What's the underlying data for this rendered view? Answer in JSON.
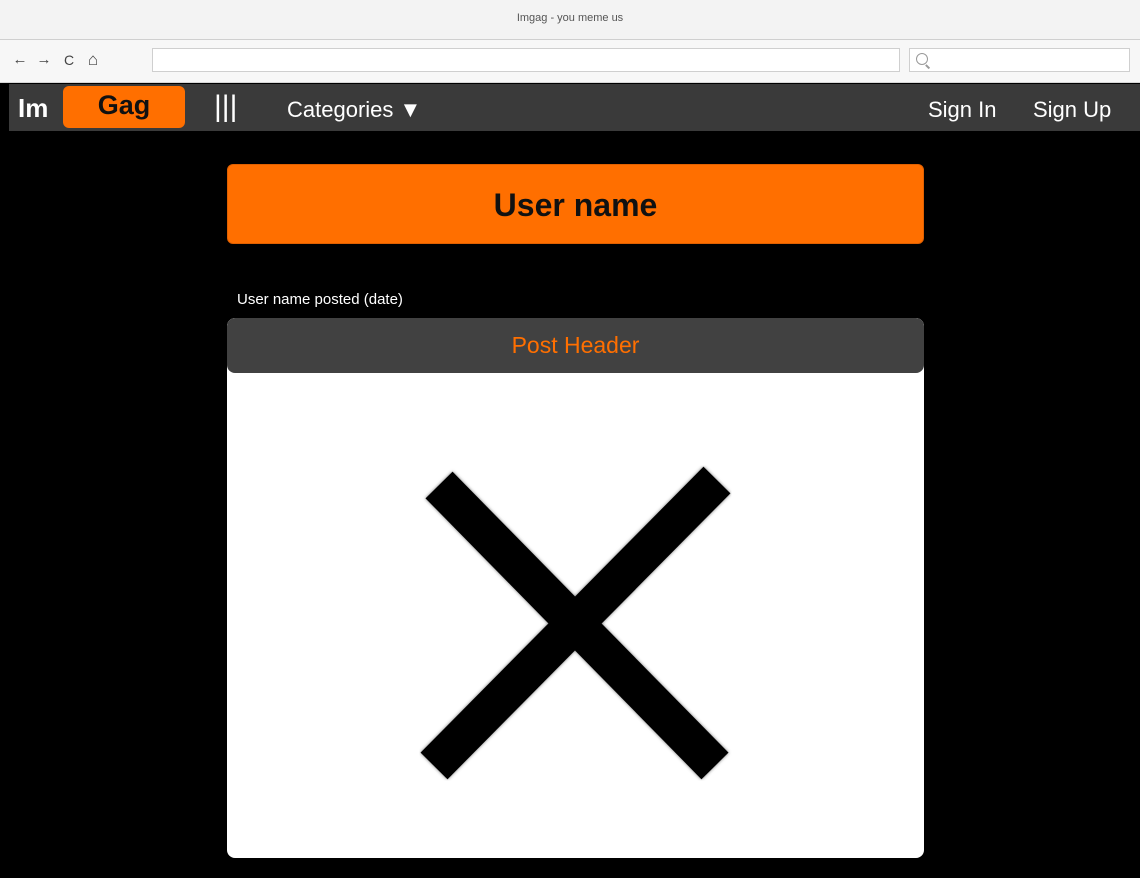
{
  "browser": {
    "window_title": "Imgag - you meme us",
    "nav": {
      "back": "←",
      "forward": "→",
      "reload": "C",
      "home": "⌂"
    },
    "url": ""
  },
  "header": {
    "logo_im": "Im",
    "logo_gag": "Gag",
    "menu_glyph": "|||",
    "categories_label": "Categories ▼",
    "sign_in": "Sign In",
    "sign_up": "Sign Up"
  },
  "profile": {
    "username_title": "User name"
  },
  "post": {
    "meta": "User name posted (date)",
    "header": "Post Header",
    "image_icon": "image-placeholder-x-icon"
  },
  "colors": {
    "accent": "#ff6f00",
    "header_bg": "#3a3a3a",
    "page_bg": "#000000"
  }
}
